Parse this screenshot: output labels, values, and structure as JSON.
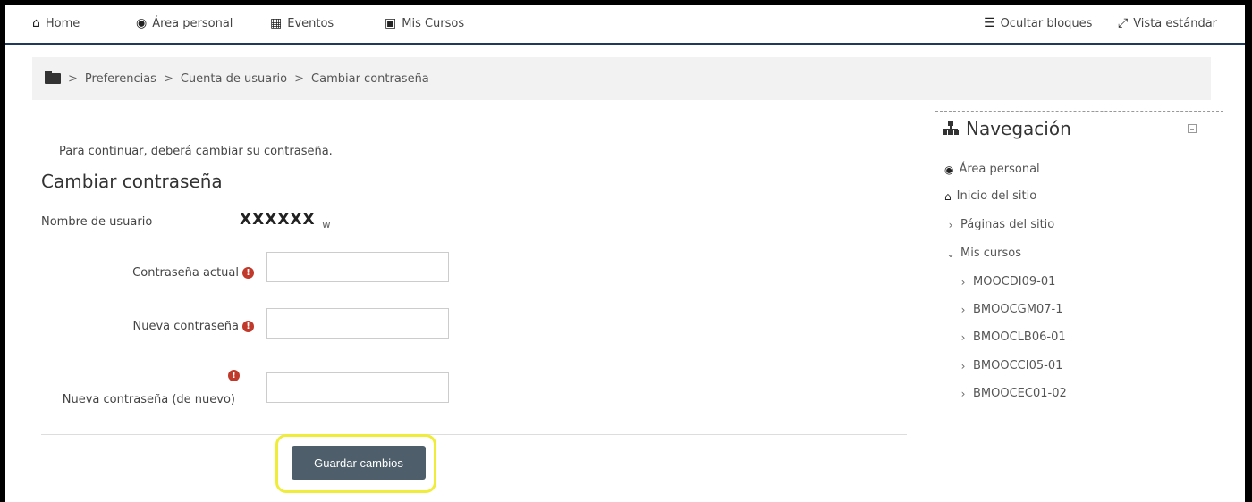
{
  "navbar": {
    "home": "Home",
    "area_personal": "Área personal",
    "eventos": "Eventos",
    "mis_cursos": "Mis Cursos",
    "ocultar_bloques": "Ocultar bloques",
    "vista_estandar": "Vista estándar"
  },
  "breadcrumb": {
    "items": [
      "Preferencias",
      "Cuenta de usuario",
      "Cambiar contraseña"
    ],
    "separator": ">"
  },
  "main": {
    "notice": "Para continuar, deberá cambiar su contraseña.",
    "heading": "Cambiar contraseña",
    "username_label": "Nombre de usuario",
    "username_value": "XXXXXX",
    "username_suffix": "w",
    "fields": [
      {
        "label": "Contraseña actual",
        "value": "",
        "required": true
      },
      {
        "label": "Nueva contraseña",
        "value": "",
        "required": true
      },
      {
        "label": "Nueva contraseña (de nuevo)",
        "value": "",
        "required": true
      }
    ],
    "required_glyph": "!",
    "save_button": "Guardar cambios"
  },
  "sidebar": {
    "title": "Navegación",
    "items": [
      {
        "label": "Área personal",
        "icon": "dashboard-icon"
      },
      {
        "label": "Inicio del sitio",
        "icon": "home-icon"
      },
      {
        "label": "Páginas del sitio",
        "icon": "chevron-right-icon"
      },
      {
        "label": "Mis cursos",
        "icon": "chevron-down-icon"
      }
    ],
    "courses": [
      "MOOCDI09-01",
      "BMOOCGM07-1",
      "BMOOCLB06-01",
      "BMOOCCI05-01",
      "BMOOCEC01-02"
    ]
  },
  "colors": {
    "navbar_border": "#1f3a5a",
    "button_bg": "#4e5e6a",
    "highlight": "#f0ec3a",
    "required": "#c0392b"
  }
}
